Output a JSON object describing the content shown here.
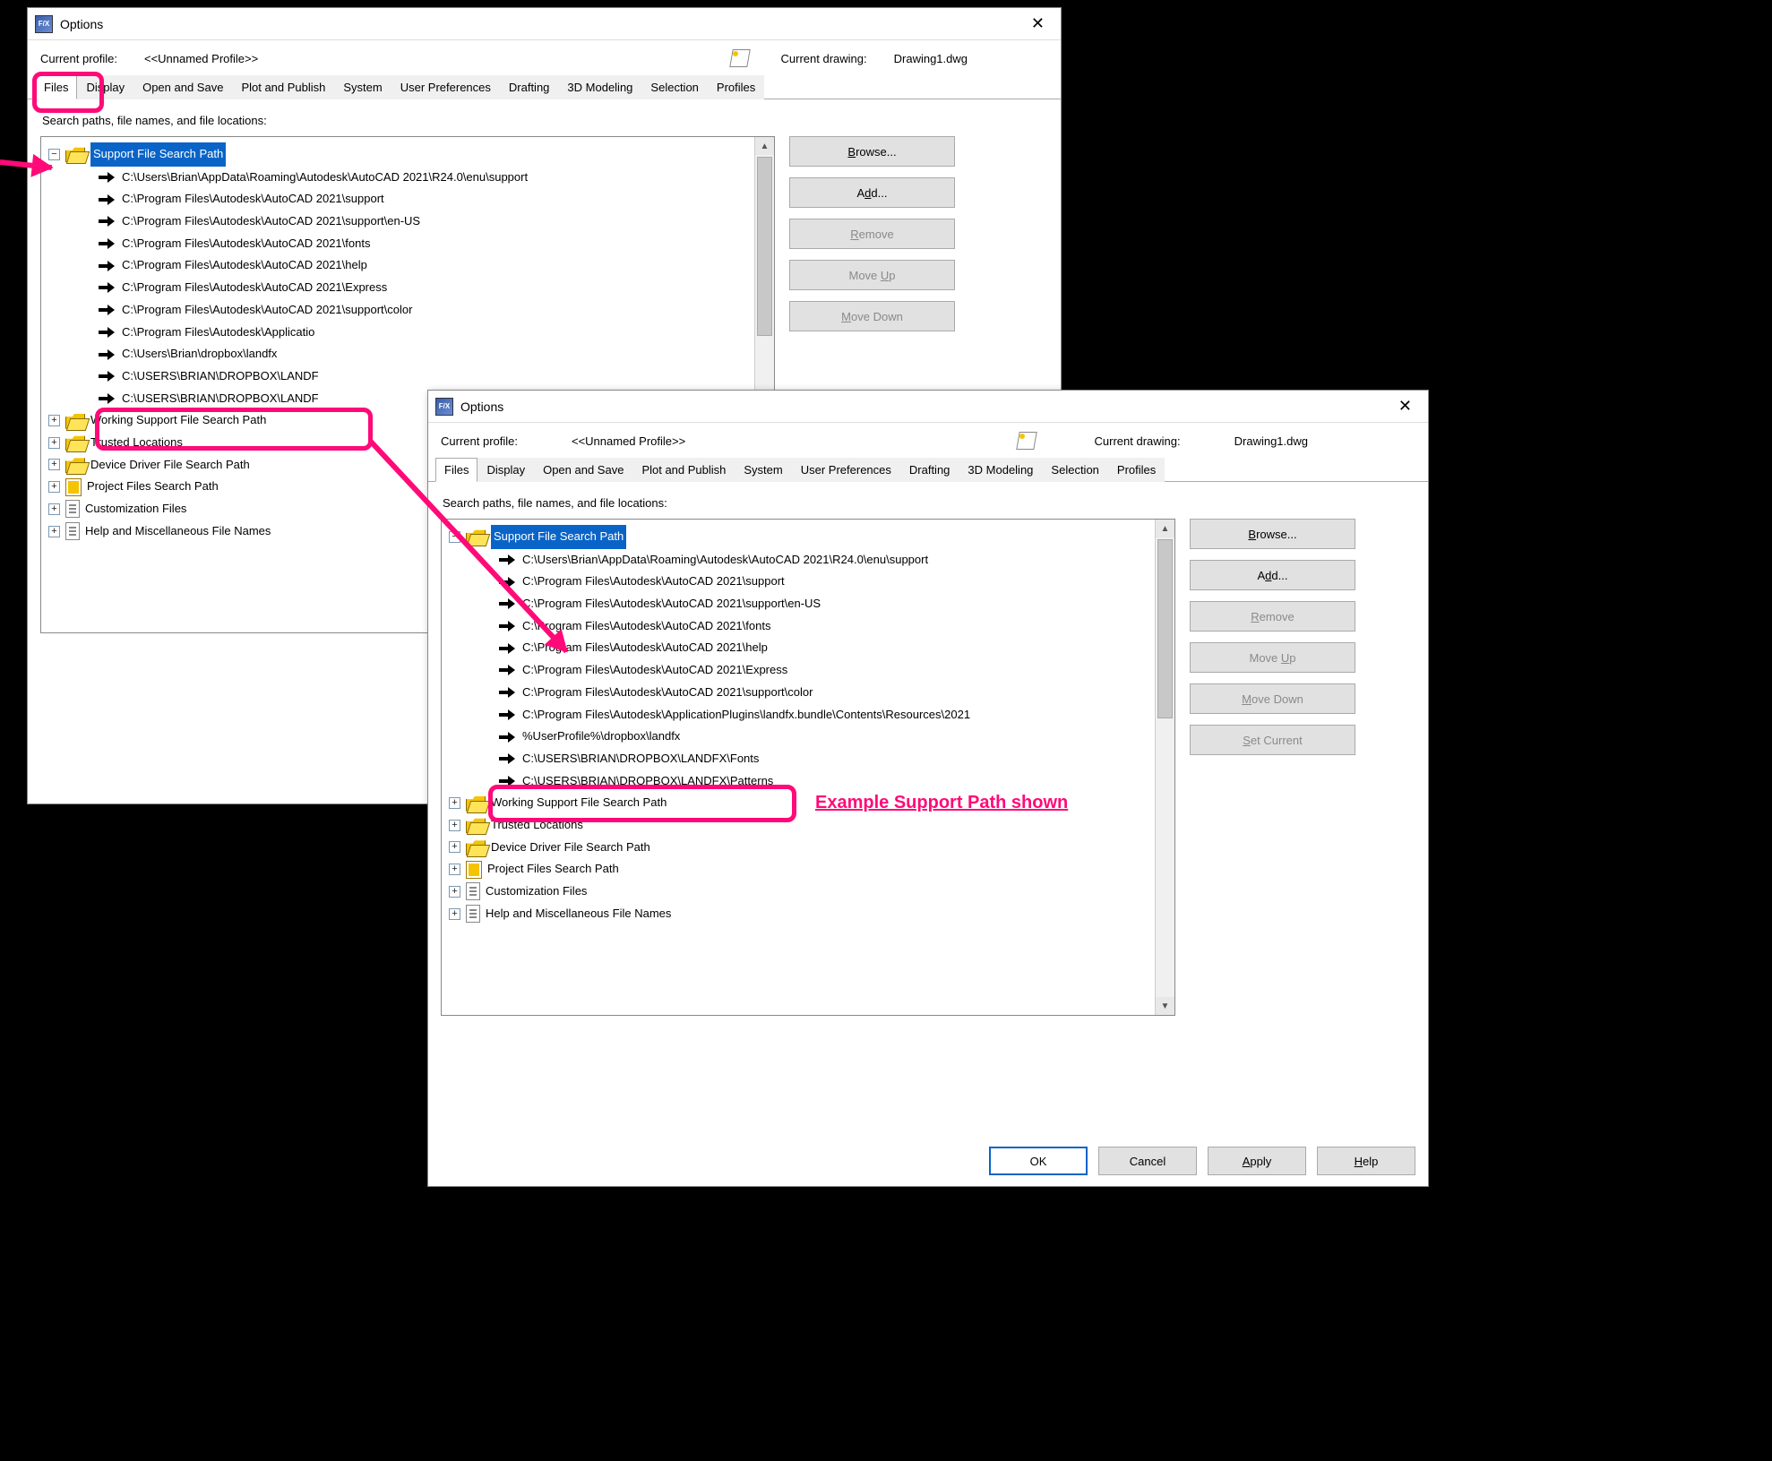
{
  "dialog1": {
    "title": "Options",
    "profile_label": "Current profile:",
    "profile_value": "<<Unnamed Profile>>",
    "drawing_label": "Current drawing:",
    "drawing_value": "Drawing1.dwg",
    "subtitle": "Search paths, file names, and file locations:",
    "selected": "Support File Search Path",
    "paths": [
      "C:\\Users\\Brian\\AppData\\Roaming\\Autodesk\\AutoCAD 2021\\R24.0\\enu\\support",
      "C:\\Program Files\\Autodesk\\AutoCAD 2021\\support",
      "C:\\Program Files\\Autodesk\\AutoCAD 2021\\support\\en-US",
      "C:\\Program Files\\Autodesk\\AutoCAD 2021\\fonts",
      "C:\\Program Files\\Autodesk\\AutoCAD 2021\\help",
      "C:\\Program Files\\Autodesk\\AutoCAD 2021\\Express",
      "C:\\Program Files\\Autodesk\\AutoCAD 2021\\support\\color",
      "C:\\Program Files\\Autodesk\\Applicatio",
      "C:\\Users\\Brian\\dropbox\\landfx",
      "C:\\USERS\\BRIAN\\DROPBOX\\LANDF",
      "C:\\USERS\\BRIAN\\DROPBOX\\LANDF"
    ],
    "siblings": [
      "Working Support File Search Path",
      "Trusted Locations",
      "Device Driver File Search Path",
      "Project Files Search Path",
      "Customization Files",
      "Help and Miscellaneous File Names"
    ]
  },
  "dialog2": {
    "title": "Options",
    "profile_label": "Current profile:",
    "profile_value": "<<Unnamed Profile>>",
    "drawing_label": "Current drawing:",
    "drawing_value": "Drawing1.dwg",
    "subtitle": "Search paths, file names, and file locations:",
    "selected": "Support File Search Path",
    "paths": [
      "C:\\Users\\Brian\\AppData\\Roaming\\Autodesk\\AutoCAD 2021\\R24.0\\enu\\support",
      "C:\\Program Files\\Autodesk\\AutoCAD 2021\\support",
      "C:\\Program Files\\Autodesk\\AutoCAD 2021\\support\\en-US",
      "C:\\Program Files\\Autodesk\\AutoCAD 2021\\fonts",
      "C:\\Program Files\\Autodesk\\AutoCAD 2021\\help",
      "C:\\Program Files\\Autodesk\\AutoCAD 2021\\Express",
      "C:\\Program Files\\Autodesk\\AutoCAD 2021\\support\\color",
      "C:\\Program Files\\Autodesk\\ApplicationPlugins\\landfx.bundle\\Contents\\Resources\\2021",
      "%UserProfile%\\dropbox\\landfx",
      "C:\\USERS\\BRIAN\\DROPBOX\\LANDFX\\Fonts",
      "C:\\USERS\\BRIAN\\DROPBOX\\LANDFX\\Patterns"
    ],
    "siblings": [
      "Working Support File Search Path",
      "Trusted Locations",
      "Device Driver File Search Path",
      "Project Files Search Path",
      "Customization Files",
      "Help and Miscellaneous File Names"
    ]
  },
  "tabs": [
    "Files",
    "Display",
    "Open and Save",
    "Plot and Publish",
    "System",
    "User Preferences",
    "Drafting",
    "3D Modeling",
    "Selection",
    "Profiles"
  ],
  "buttons": {
    "browse": "Browse...",
    "add": "Add...",
    "remove": "Remove",
    "moveup": "Move Up",
    "movedown": "Move Down",
    "setcurrent": "Set Current"
  },
  "footer": {
    "ok": "OK",
    "cancel": "Cancel",
    "apply": "Apply",
    "help": "Help"
  },
  "annotation": {
    "label": "Example Support Path shown"
  }
}
